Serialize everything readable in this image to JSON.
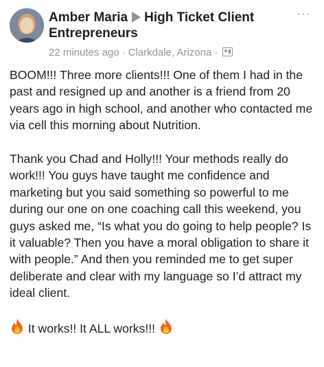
{
  "post": {
    "author": "Amber Maria",
    "group": "High Ticket Client Entrepreneurs",
    "timestamp": "22 minutes ago",
    "separator": "·",
    "location": "Clarkdale, Arizona",
    "more_label": "···",
    "paragraphs": [
      "BOOM!!! Three more clients!!! One of them I had in the past and resigned up and another is a friend from 20 years ago in high school, and another who contacted me via cell this morning about Nutrition.",
      "Thank you Chad and Holly!!! Your methods really do work!!! You guys have taught me confidence and marketing but you said something so powerful to me during our one on one coaching call this weekend, you guys asked me, “Is what you do going to help people? Is it valuable? Then you have a moral obligation to share it with people.” And then you reminded me to get super deliberate and clear with my language so I’d attract my ideal client."
    ],
    "closing_text": "It works!! It ALL works!!!",
    "closing_icon": "fire-icon",
    "audience_icon": "image-icon"
  }
}
